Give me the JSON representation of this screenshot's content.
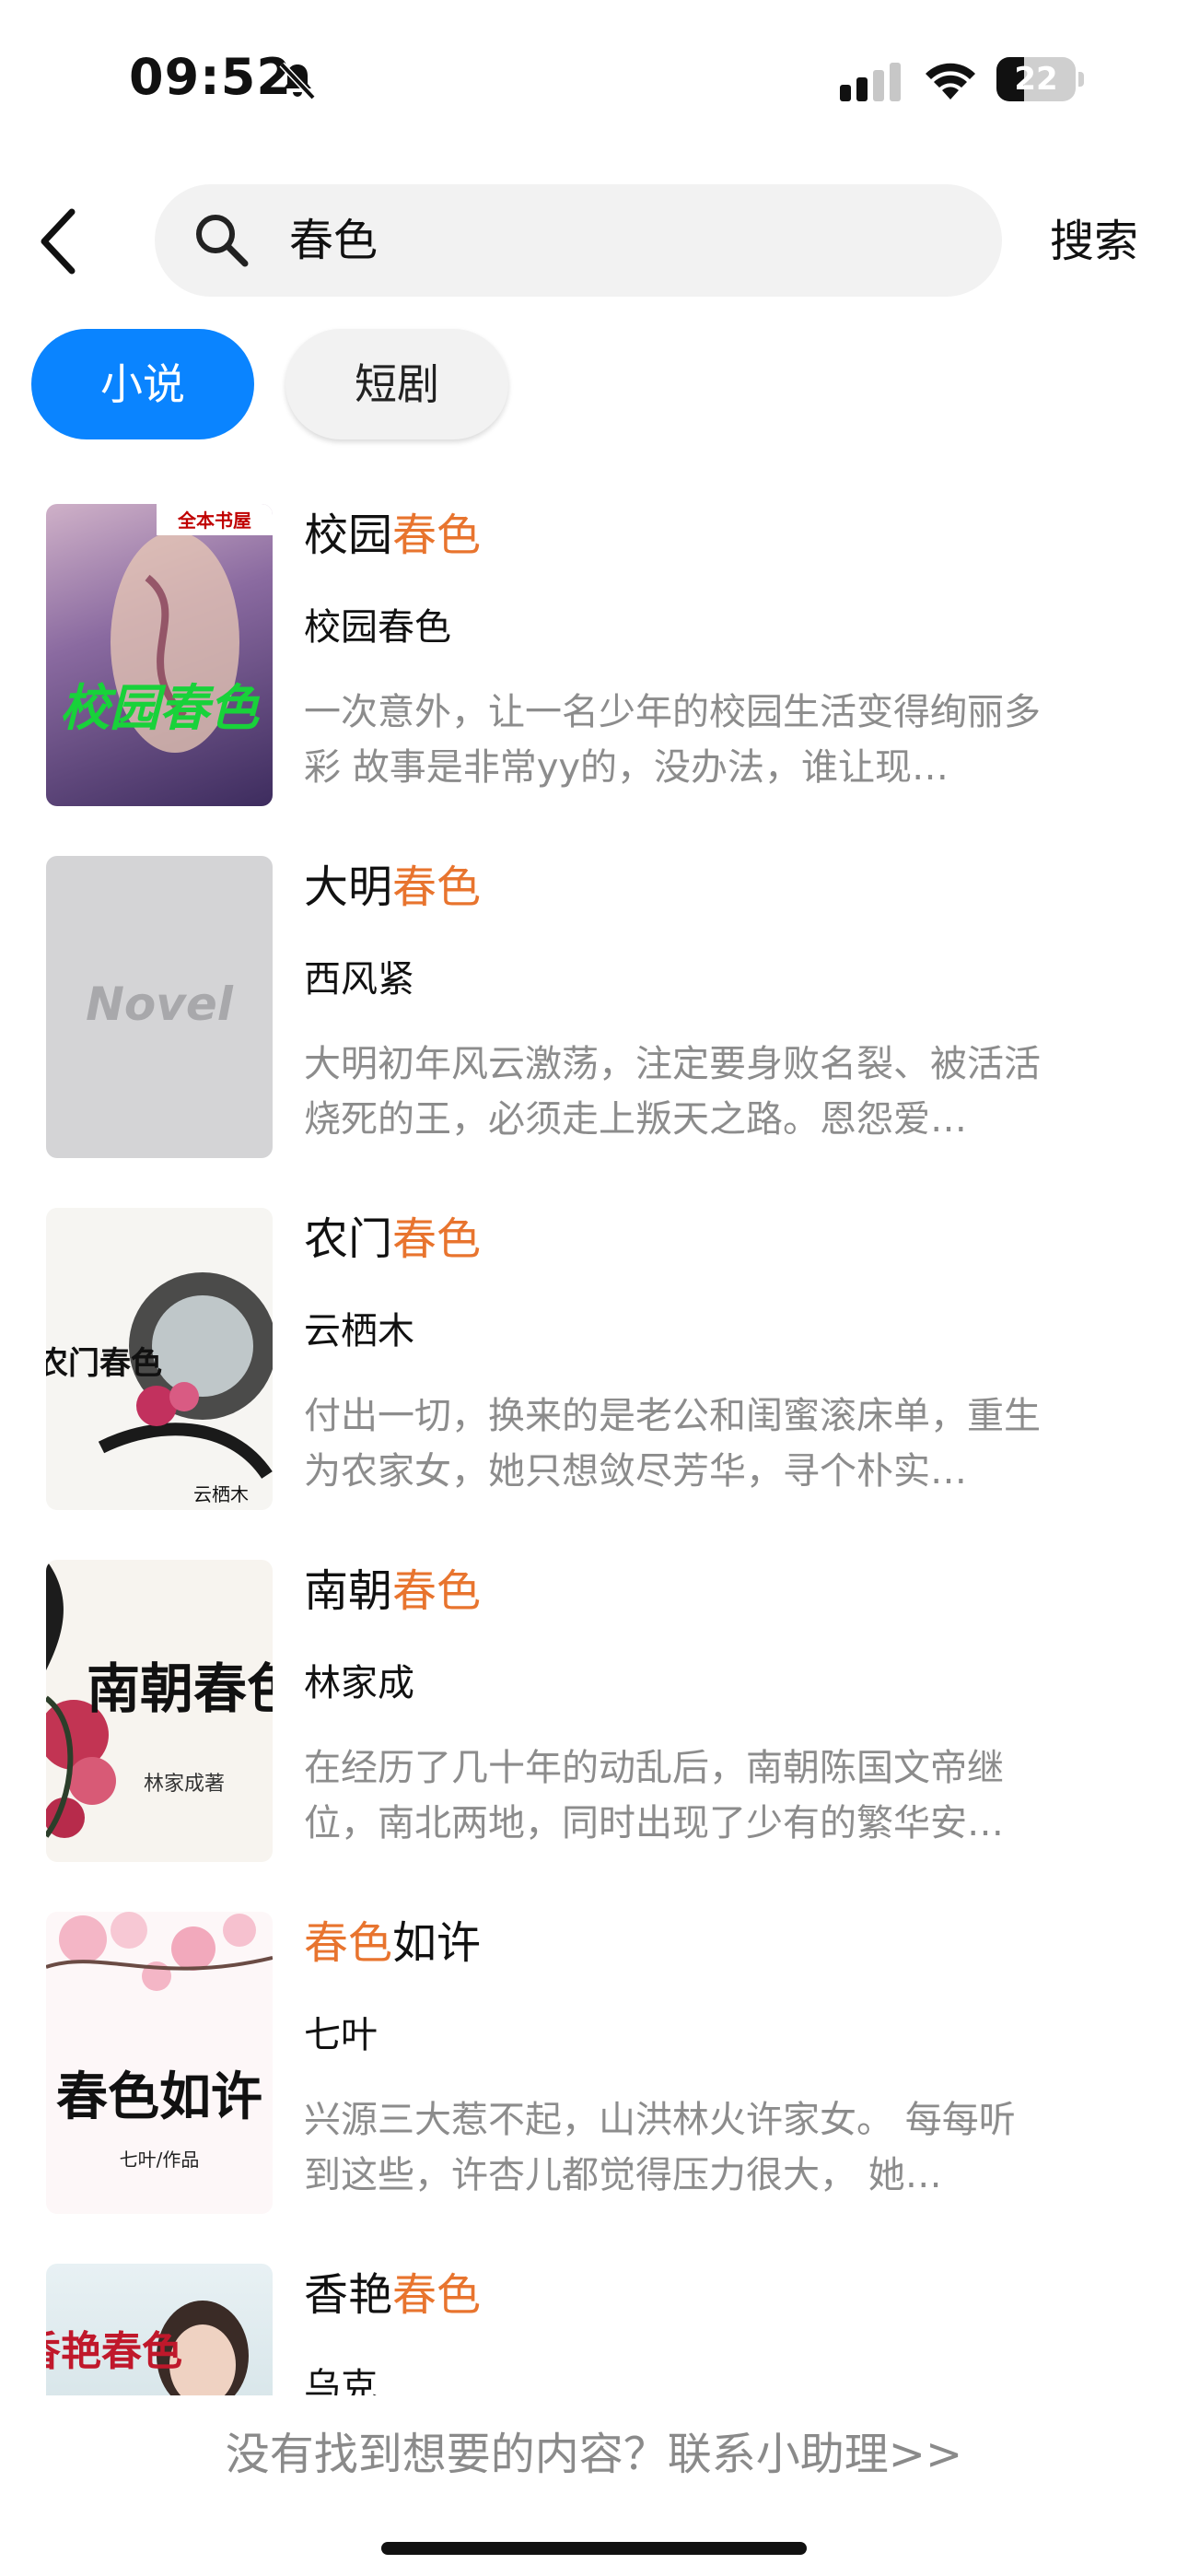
{
  "status_bar": {
    "time": "09:52",
    "battery": "22"
  },
  "search": {
    "query": "春色",
    "button_label": "搜索"
  },
  "tabs": [
    {
      "label": "小说",
      "active": true
    },
    {
      "label": "短剧",
      "active": false
    }
  ],
  "results": [
    {
      "title_pre": "校园",
      "title_hl": "春色",
      "title_post": "",
      "author": "校园春色",
      "desc": "一次意外，让一名少年的校园生活变得绚丽多彩 故事是非常yy的，没办法，谁让现…",
      "cover_text": "校园春色",
      "cover_badge": "全本书屋"
    },
    {
      "title_pre": "大明",
      "title_hl": "春色",
      "title_post": "",
      "author": "西风紧",
      "desc": "大明初年风云激荡，注定要身败名裂、被活活烧死的王，必须走上叛天之路。恩怨爱…",
      "cover_text": "Novel"
    },
    {
      "title_pre": "农门",
      "title_hl": "春色",
      "title_post": "",
      "author": "云栖木",
      "desc": "付出一切，换来的是老公和闺蜜滚床单，重生为农家女，她只想敛尽芳华，寻个朴实…",
      "cover_text": "农门春色",
      "cover_sub": "云栖木"
    },
    {
      "title_pre": "南朝",
      "title_hl": "春色",
      "title_post": "",
      "author": "林家成",
      "desc": "在经历了几十年的动乱后，南朝陈国文帝继位，南北两地，同时出现了少有的繁华安…",
      "cover_text": "南朝春色",
      "cover_sub": "林家成著"
    },
    {
      "title_pre": "",
      "title_hl": "春色",
      "title_post": "如许",
      "author": "七叶",
      "desc": "兴源三大惹不起，山洪林火许家女。 每每听到这些，许杏儿都觉得压力很大， 她…",
      "cover_text": "春色如许",
      "cover_sub": "七叶/作品"
    },
    {
      "title_pre": "香艳",
      "title_hl": "春色",
      "title_post": "",
      "author": "乌克",
      "desc": "",
      "cover_text": "香艳春色"
    }
  ],
  "footer": {
    "help_text": "没有找到想要的内容？联系小助理>>"
  },
  "colors": {
    "accent": "#0a84ff",
    "highlight": "#e8742e",
    "muted": "#8c8c8c"
  }
}
